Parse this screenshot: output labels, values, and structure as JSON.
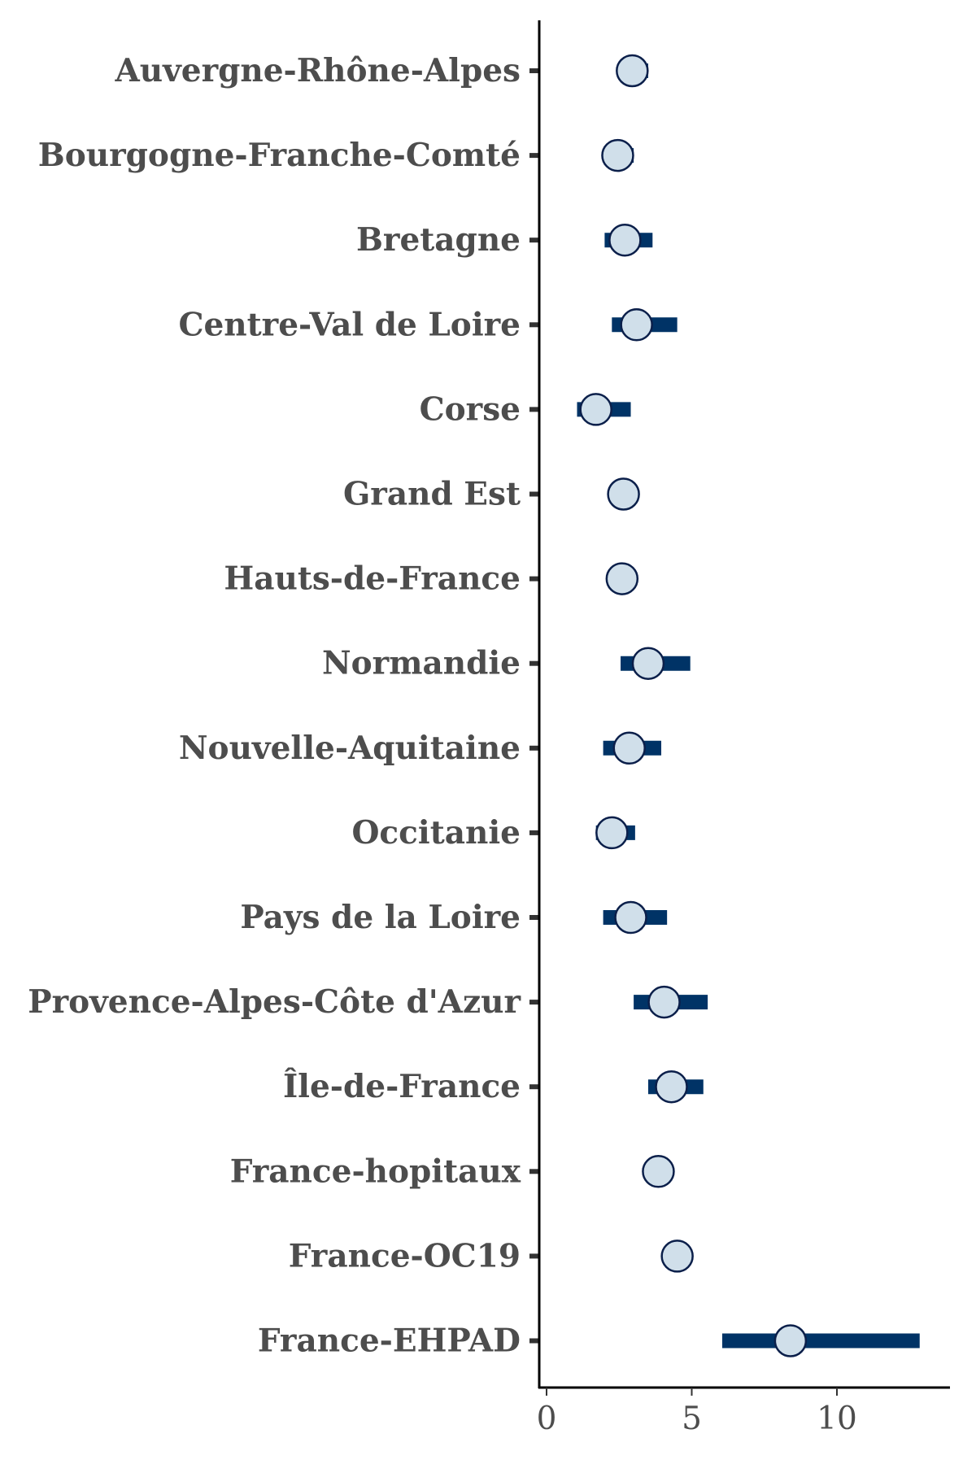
{
  "chart_data": {
    "type": "forest",
    "orientation": "horizontal",
    "categories": [
      "Auvergne-Rhône-Alpes",
      "Bourgogne-Franche-Comté",
      "Bretagne",
      "Centre-Val de Loire",
      "Corse",
      "Grand Est",
      "Hauts-de-France",
      "Normandie",
      "Nouvelle-Aquitaine",
      "Occitanie",
      "Pays de la Loire",
      "Provence-Alpes-Côte d'Azur",
      "Île-de-France",
      "France-hopitaux",
      "France-OC19",
      "France-EHPAD"
    ],
    "estimates": [
      2.95,
      2.45,
      2.7,
      3.1,
      1.7,
      2.65,
      2.6,
      3.5,
      2.85,
      2.25,
      2.9,
      4.05,
      4.3,
      3.85,
      4.5,
      8.4
    ],
    "ci_lower": [
      2.6,
      2.05,
      2.0,
      2.25,
      1.05,
      2.45,
      2.35,
      2.55,
      1.95,
      1.7,
      1.95,
      3.0,
      3.5,
      3.6,
      4.25,
      6.05
    ],
    "ci_upper": [
      3.5,
      3.0,
      3.65,
      4.5,
      2.9,
      2.9,
      2.85,
      4.95,
      3.95,
      3.05,
      4.15,
      5.55,
      5.4,
      4.1,
      4.75,
      12.85
    ],
    "xticks": [
      0,
      5,
      10
    ],
    "xlim": [
      -0.1,
      13.8
    ],
    "title": "",
    "xlabel": "",
    "ylabel": "",
    "grid": false,
    "colors": {
      "ci_bar": "#003366",
      "point_fill": "#d0dfea",
      "point_stroke": "#0b1f4a",
      "axis": "#000000",
      "text": "#4d4d4d",
      "tick_mark": "#333333"
    }
  }
}
